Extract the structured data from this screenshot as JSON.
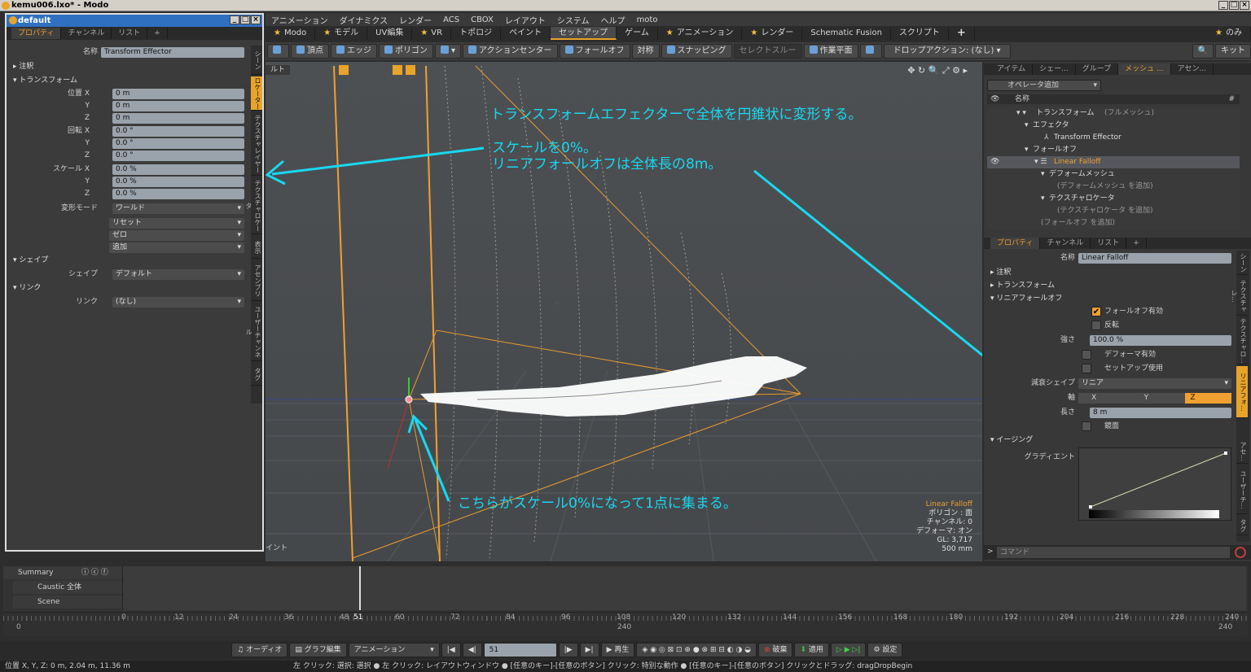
{
  "window": {
    "title": "kemu006.lxo* - Modo"
  },
  "menu": [
    "アニメーション",
    "ダイナミクス",
    "レンダー",
    "ACS",
    "CBOX",
    "レイアウト",
    "システム",
    "ヘルプ",
    "moto"
  ],
  "tabs": [
    {
      "label": "Modo",
      "star": true
    },
    {
      "label": "モデル",
      "star": true
    },
    {
      "label": "UV編集",
      "star": false
    },
    {
      "label": "VR",
      "star": true
    },
    {
      "label": "トポロジ",
      "star": false
    },
    {
      "label": "ペイント",
      "star": false
    },
    {
      "label": "セットアップ",
      "star": false,
      "active": true
    },
    {
      "label": "ゲーム",
      "star": false
    },
    {
      "label": "アニメーション",
      "star": true
    },
    {
      "label": "レンダー",
      "star": true
    },
    {
      "label": "Schematic Fusion",
      "star": false
    },
    {
      "label": "スクリプト",
      "star": false
    }
  ],
  "tab_add": "+",
  "tab_right": "のみ",
  "toolbar": {
    "vertex": "頂点",
    "edge": "エッジ",
    "polygon": "ポリゴン",
    "action_center": "アクションセンター",
    "falloff": "フォールオフ",
    "symmetry": "対称",
    "snapping": "スナッピング",
    "select_through": "セレクトスルー",
    "work_plane": "作業平面",
    "drop_action": "ドロップアクション: (なし)",
    "kit": "キット"
  },
  "left_panel": {
    "title": "default",
    "tabs": [
      "プロパティ",
      "チャンネル",
      "リスト",
      "+"
    ],
    "name_label": "名称",
    "name_value": "Transform Effector",
    "annotation": "注釈",
    "transform": "トランスフォーム",
    "position_label": "位置",
    "position": [
      "0 m",
      "0 m",
      "0 m"
    ],
    "rotation_label": "回転",
    "rotation": [
      "0.0 °",
      "0.0 °",
      "0.0 °"
    ],
    "scale_label": "スケール",
    "scale": [
      "0.0 %",
      "0.0 %",
      "0.0 %"
    ],
    "axes": [
      "X",
      "Y",
      "Z"
    ],
    "deform_mode_label": "変形モード",
    "deform_mode": "ワールド",
    "reset": "リセット",
    "zero": "ゼロ",
    "add": "追加",
    "shape_section": "シェイプ",
    "shape_label": "シェイプ",
    "shape_value": "デフォルト",
    "link_section": "リンク",
    "link_label": "リンク",
    "link_value": "(なし)",
    "vtabs": [
      "シーン",
      "ロケーター",
      "テクスチャレイヤー",
      "テクスチャロケータ",
      "表示",
      "アセンブリ",
      "ユーザーチャンネル",
      "タグ"
    ]
  },
  "viewport": {
    "partial_left_label": "ルト",
    "partial_bottom_label": "イント",
    "notes": [
      "トランスフォームエフェクターで全体を円錐状に変形する。",
      "スケールを0%。",
      "リニアフォールオフは全体長の8m。",
      "こちらがスケール0%になって1点に集まる。"
    ],
    "overlay": [
      "Linear Falloff",
      "ポリゴン : 面",
      "チャンネル: 0",
      "デフォーマ: オン",
      "GL: 3,717",
      "500 mm"
    ]
  },
  "right_panel": {
    "tabs": [
      "アイテム",
      "シェー...",
      "グループ",
      "メッシュ ...",
      "アセン..."
    ],
    "add_operator": "オペレータ追加",
    "col_name": "名称",
    "col_hash": "#",
    "tree": [
      {
        "label": "トランスフォーム",
        "extra": "(フルメッシュ)",
        "indent": 0
      },
      {
        "label": "エフェクタ",
        "extra": "",
        "indent": 1
      },
      {
        "label": "Transform Effector",
        "extra": "",
        "indent": 2
      },
      {
        "label": "フォールオフ",
        "extra": "",
        "indent": 1
      },
      {
        "label": "Linear Falloff",
        "extra": "",
        "indent": 2,
        "selected": true
      },
      {
        "label": "デフォームメッシュ",
        "extra": "",
        "indent": 3
      },
      {
        "label": "",
        "extra": "(デフォームメッシュ を追加)",
        "indent": 4
      },
      {
        "label": "テクスチャロケータ",
        "extra": "",
        "indent": 3
      },
      {
        "label": "",
        "extra": "(テクスチャロケータ を追加)",
        "indent": 4
      },
      {
        "label": "",
        "extra": "(フォールオフ を追加)",
        "indent": 2
      }
    ],
    "prop_tabs": [
      "プロパティ",
      "チャンネル",
      "リスト",
      "+"
    ],
    "name_label": "名称",
    "name_value": "Linear Falloff",
    "annotation": "注釈",
    "transform": "トランスフォーム",
    "linear_falloff": "リニアフォールオフ",
    "falloff_enable": "フォールオフ有効",
    "invert": "反転",
    "strength_label": "強さ",
    "strength": "100.0 %",
    "deformer_enable": "デフォーマ有効",
    "use_setup": "セットアップ使用",
    "decay_shape_label": "減衰シェイプ",
    "decay_shape": "リニア",
    "axis_label": "軸",
    "axis_options": [
      "X",
      "Y",
      "Z"
    ],
    "length_label": "長さ",
    "length": "8 m",
    "mirror": "鏡面",
    "easing": "イージング",
    "gradient": "グラディエント",
    "command": "コマンド",
    "vtabs": [
      "シーン",
      "テクスチャレ...",
      "テクスチャロ...",
      "リニアフォ...",
      "アセ...",
      "ユーザーチ...",
      "タグ"
    ]
  },
  "timeline": {
    "summary": "Summary",
    "rows": [
      "Caustic 全体",
      "Scene"
    ],
    "ticks": [
      "0",
      "12",
      "24",
      "36",
      "48",
      "51",
      "60",
      "72",
      "84",
      "96",
      "108",
      "120",
      "132",
      "144",
      "156",
      "168",
      "180",
      "192",
      "204",
      "216",
      "228",
      "240"
    ],
    "start": "0",
    "mid": "240",
    "end": "240",
    "current_frame": 51
  },
  "bottom": {
    "audio": "オーディオ",
    "graph": "グラフ編集",
    "animation": "アニメーション",
    "frame": "51",
    "play": "再生",
    "discard": "破棄",
    "apply": "適用",
    "settings": "設定"
  },
  "status": {
    "position": "位置 X, Y, Z:   0 m, 2.04 m, 11.36 m",
    "hint": "左 クリック: 選択: 選択 ● 左 クリック: レイアウトウィンドウ ● [任意のキー]-[任意のボタン] クリック: 特別な動作 ● [任意のキー]-[任意のボタン] クリックとドラッグ: dragDropBegin"
  },
  "colors": {
    "accent": "#e8a32a",
    "note": "#18d8f0",
    "selection": "#55575c"
  }
}
